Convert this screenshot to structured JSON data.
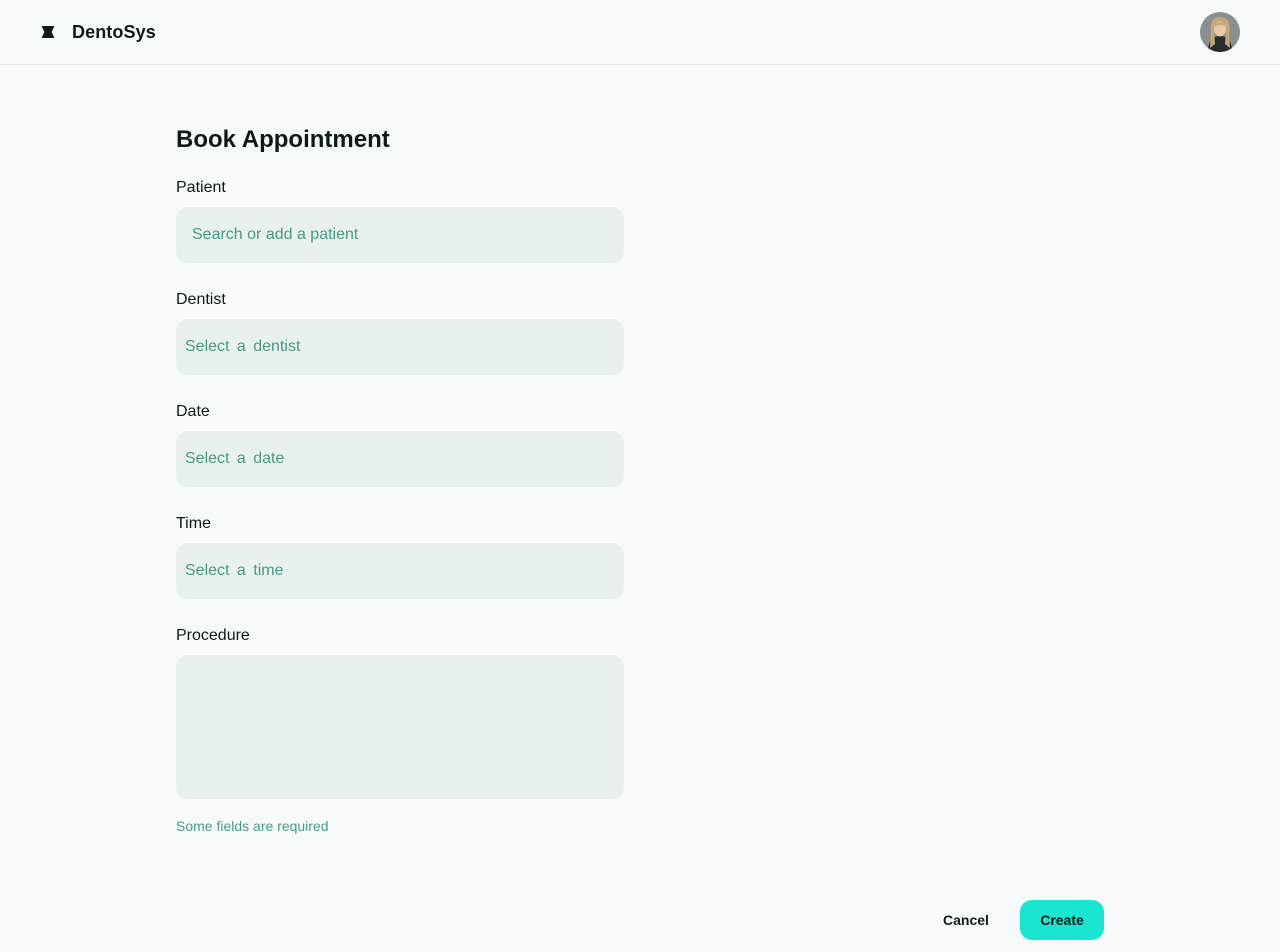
{
  "app": {
    "name": "DentoSys",
    "logo_icon": "dental-logo-icon",
    "avatar_icon": "user-avatar"
  },
  "form": {
    "title": "Book Appointment",
    "patient": {
      "label": "Patient",
      "placeholder": "Search or add a patient"
    },
    "dentist": {
      "label": "Dentist",
      "placeholder": "Select a dentist"
    },
    "date": {
      "label": "Date",
      "placeholder": "Select a date"
    },
    "time": {
      "label": "Time",
      "placeholder": "Select a time"
    },
    "procedure": {
      "label": "Procedure",
      "value": ""
    },
    "hint": "Some fields are required"
  },
  "actions": {
    "cancel_label": "Cancel",
    "create_label": "Create"
  },
  "colors": {
    "background": "#f7fafa",
    "field_background": "#e8f0f0",
    "placeholder_text": "#4a9a85",
    "primary_button": "#19e5d1",
    "text": "#0e1a17"
  }
}
